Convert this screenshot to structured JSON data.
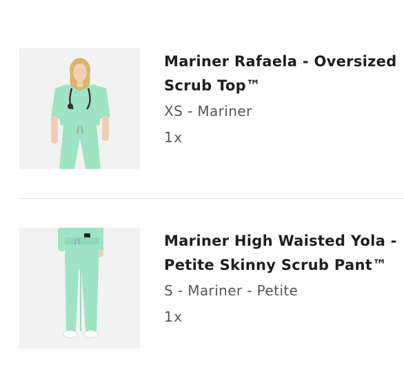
{
  "cart": {
    "items": [
      {
        "title_line1": "Mariner Rafaela - Oversized",
        "title_line2": "Scrub Top™",
        "variant": "XS - Mariner",
        "quantity": "1x",
        "image_icon": "product-photo-scrub-top"
      },
      {
        "title_line1": "Mariner High Waisted Yola -",
        "title_line2": "Petite Skinny Scrub Pant™",
        "variant": "S - Mariner - Petite",
        "quantity": "1x",
        "image_icon": "product-photo-scrub-pant"
      }
    ]
  },
  "colors": {
    "scrub_mint": "#9fe3c5",
    "background": "#ffffff",
    "thumb_bg": "#f2f2f2"
  }
}
